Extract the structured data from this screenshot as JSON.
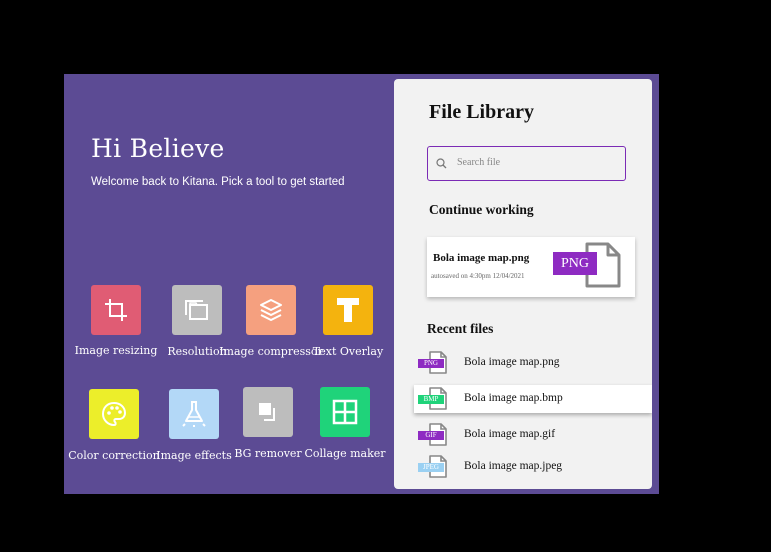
{
  "header": {
    "greeting": "Hi Believe",
    "subtitle": "Welcome back to Kitana. Pick a tool to get started"
  },
  "tools": [
    {
      "label": "Image resizing",
      "color": "#e05c74",
      "icon": "crop-icon"
    },
    {
      "label": "Resolution",
      "color": "#bdbdbd",
      "icon": "layers-stack-icon"
    },
    {
      "label": "Image compressor",
      "color": "#f5a07f",
      "icon": "stack-icon"
    },
    {
      "label": "Text Overlay",
      "color": "#f4b30e",
      "icon": "text-t-icon"
    },
    {
      "label": "Color correction",
      "color": "#ecee2a",
      "icon": "palette-icon"
    },
    {
      "label": "Image effects",
      "color": "#b3d8f7",
      "icon": "flask-icon"
    },
    {
      "label": "BG remover",
      "color": "#bdbdbd",
      "icon": "bg-remove-icon"
    },
    {
      "label": "Collage maker",
      "color": "#1fd37a",
      "icon": "grid-icon"
    }
  ],
  "library": {
    "title": "File Library",
    "search_placeholder": "Search file",
    "continue_heading": "Continue working",
    "continue_file": {
      "name": "Bola image map.png",
      "meta": "autosaved on 4:30pm 12/04/2021",
      "badge": "PNG",
      "badge_color": "#8e2bc2"
    },
    "recent_heading": "Recent files",
    "recent_files": [
      {
        "name": "Bola image map.png",
        "tag": "PNG",
        "tag_color": "#8e2bc2"
      },
      {
        "name": "Bola image map.bmp",
        "tag": "BMP",
        "tag_color": "#1fd37a"
      },
      {
        "name": "Bola image map.gif",
        "tag": "GIF",
        "tag_color": "#8e2bc2"
      },
      {
        "name": "Bola image map.jpeg",
        "tag": "JPEG",
        "tag_color": "#9ad0f2"
      }
    ]
  },
  "colors": {
    "background": "#5c4b94",
    "panel": "#f2f2f2",
    "accent": "#7b2bb5"
  }
}
